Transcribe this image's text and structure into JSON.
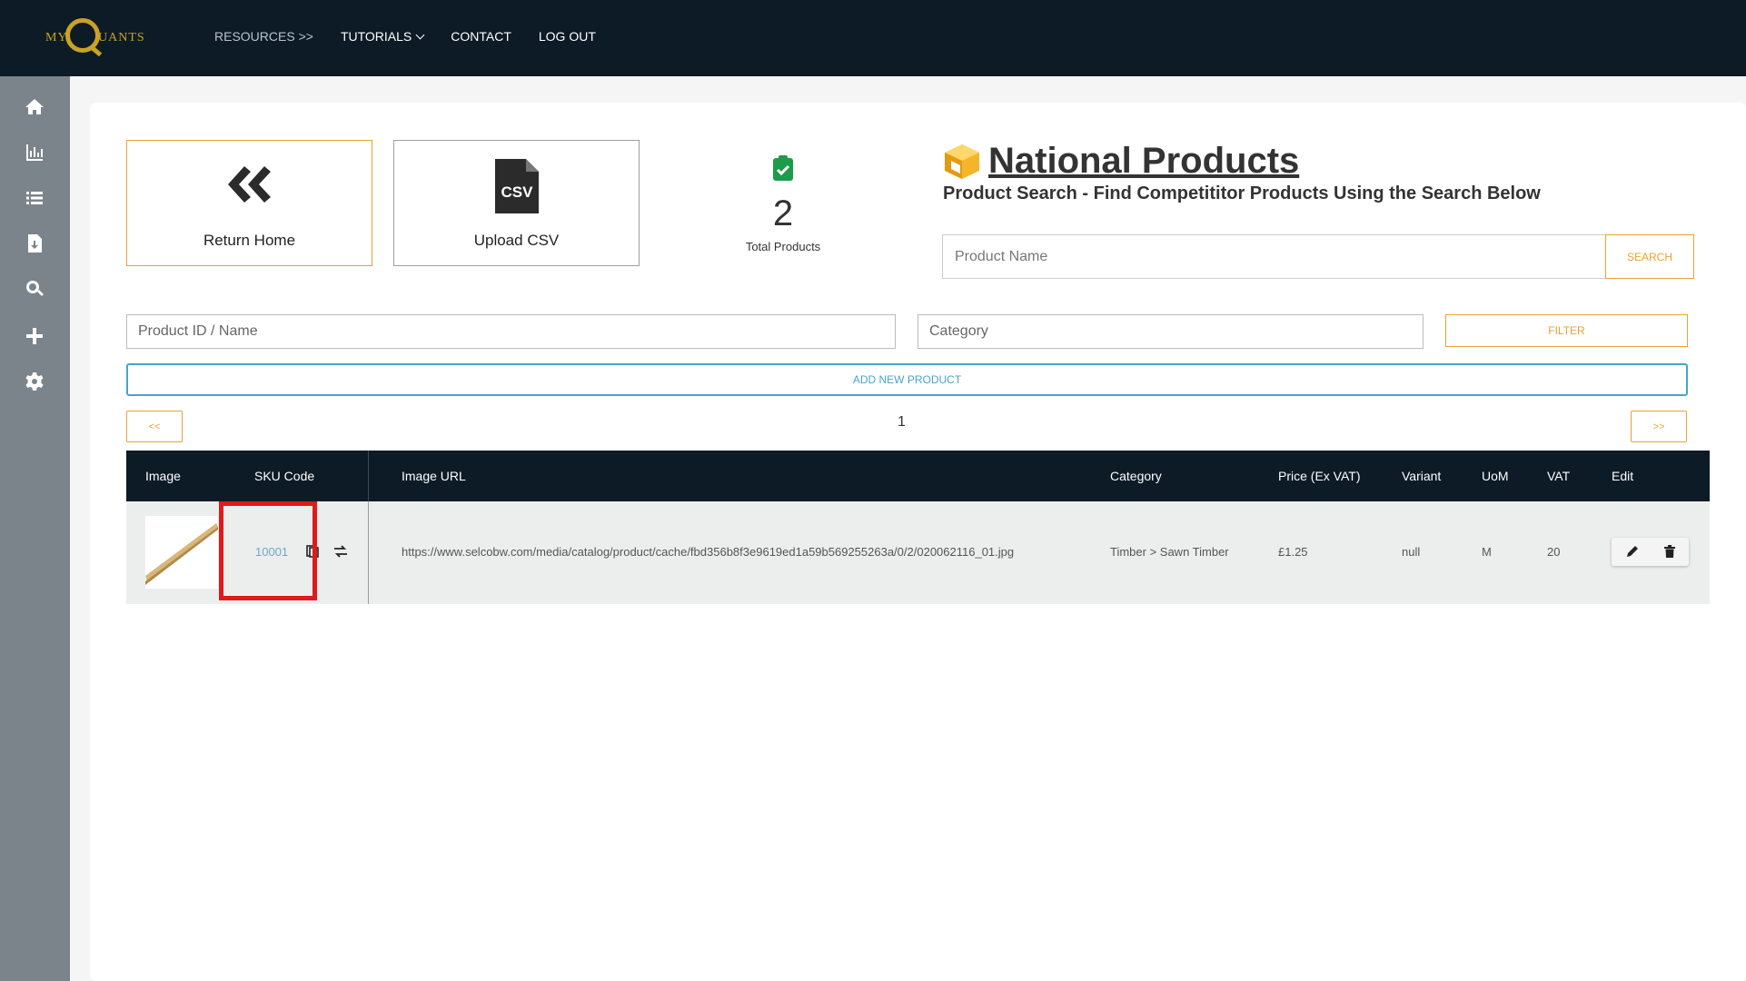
{
  "brand": {
    "prefix": "MY",
    "suffix": "UANTS",
    "accent": "#c9a227"
  },
  "nav": {
    "resources": "RESOURCES >>",
    "tutorials": "TUTORIALS",
    "contact": "CONTACT",
    "logout": "LOG OUT"
  },
  "sidebar": {
    "icons": [
      "home-icon",
      "bar-chart-icon",
      "list-icon",
      "file-download-icon",
      "search-icon",
      "plus-icon",
      "gear-icon"
    ]
  },
  "tiles": {
    "home_label": "Return Home",
    "csv_label": "Upload CSV"
  },
  "stats": {
    "total": "2",
    "total_label": "Total Products"
  },
  "header": {
    "title": "National Products",
    "subtitle": "Product Search - Find Competititor Products Using the Search Below"
  },
  "search": {
    "placeholder": "Product Name",
    "button": "SEARCH"
  },
  "filters": {
    "id_placeholder": "Product ID / Name",
    "category_placeholder": "Category",
    "button": "FILTER"
  },
  "add_button": "ADD NEW PRODUCT",
  "pagination": {
    "prev": "<<",
    "next": ">>",
    "current": "1"
  },
  "table": {
    "columns": [
      "Image",
      "SKU Code",
      "Image URL",
      "Category",
      "Price (Ex VAT)",
      "Variant",
      "UoM",
      "VAT",
      "Edit"
    ],
    "rows": [
      {
        "sku": "10001",
        "image_url": "https://www.selcobw.com/media/catalog/product/cache/fbd356b8f3e9619ed1a59b569255263a/0/2/020062116_01.jpg",
        "category": "Timber > Sawn Timber",
        "price": "£1.25",
        "variant": "null",
        "uom": "M",
        "vat": "20"
      }
    ]
  },
  "colors": {
    "navbar": "#0c1b26",
    "sidebar": "#7b848a",
    "accent_orange": "#e8a13a",
    "accent_blue": "#4aa3c8",
    "highlight": "#e01a1a"
  }
}
